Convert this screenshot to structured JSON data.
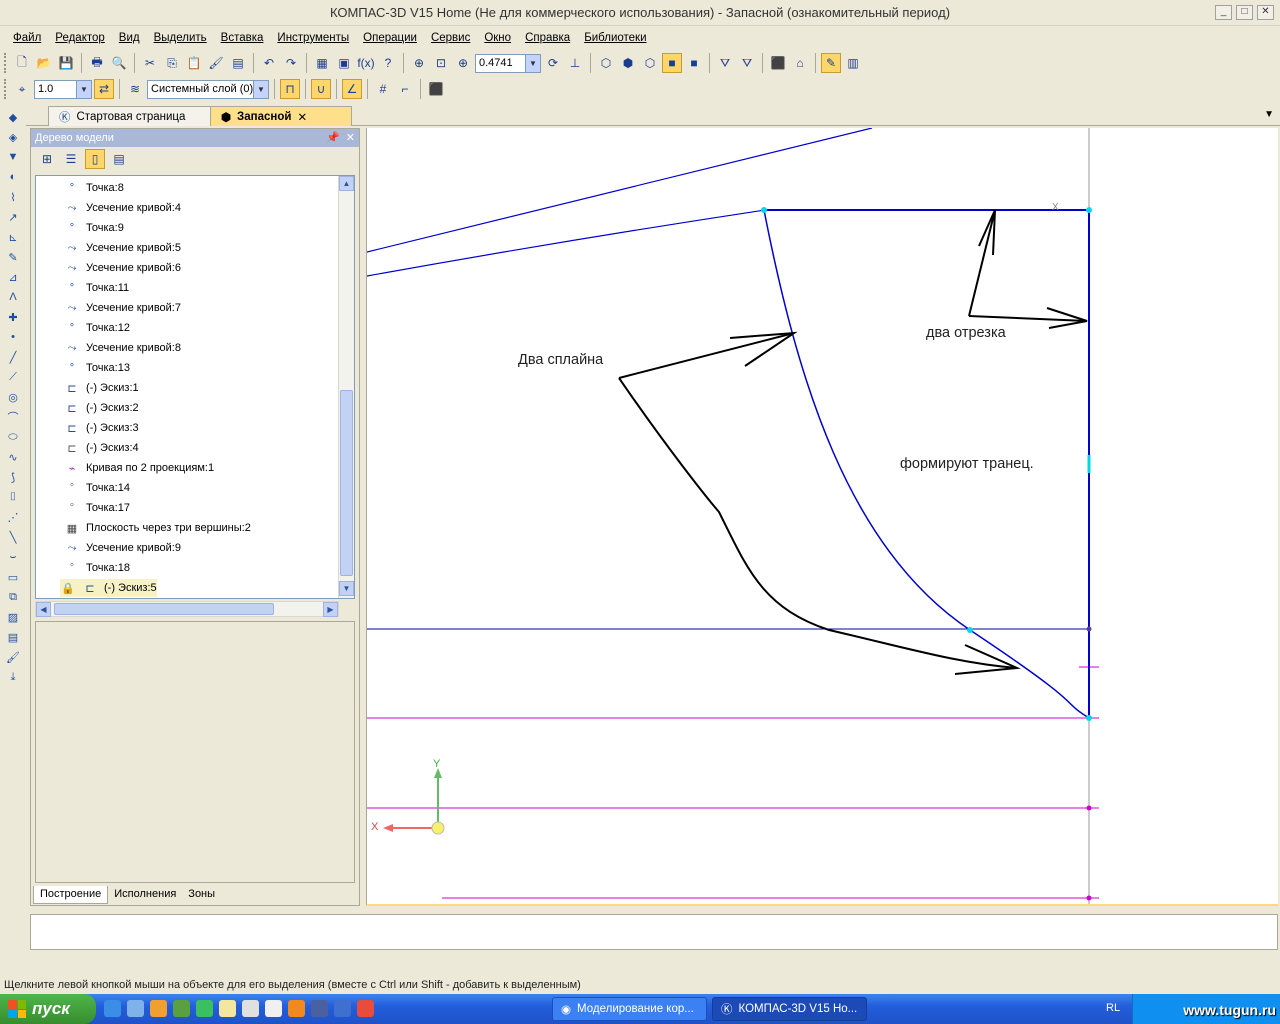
{
  "window": {
    "title": "КОМПАС-3D V15 Home (Не для коммерческого использования) - Запасной (ознакомительный период)",
    "min": "_",
    "max": "□",
    "close": "✕"
  },
  "menu": [
    "Файл",
    "Редактор",
    "Вид",
    "Выделить",
    "Вставка",
    "Инструменты",
    "Операции",
    "Сервис",
    "Окно",
    "Справка",
    "Библиотеки"
  ],
  "toolbar": {
    "zoom_value": "0.4741",
    "fx_label": "f(x)",
    "line_scale": "1.0",
    "layer_value": "Системный слой (0)"
  },
  "tabs": {
    "start_page": "Стартовая страница",
    "active_doc": "Запасной"
  },
  "tree": {
    "title": "Дерево модели",
    "items": [
      {
        "label": "Точка:8",
        "icon": "point-icon"
      },
      {
        "label": "Усечение кривой:4",
        "icon": "trim-curve-icon"
      },
      {
        "label": "Точка:9",
        "icon": "point-icon"
      },
      {
        "label": "Усечение кривой:5",
        "icon": "trim-curve-icon"
      },
      {
        "label": "Усечение кривой:6",
        "icon": "trim-curve-icon"
      },
      {
        "label": "Точка:11",
        "icon": "point-icon"
      },
      {
        "label": "Усечение кривой:7",
        "icon": "trim-curve-icon"
      },
      {
        "label": "Точка:12",
        "icon": "point-icon"
      },
      {
        "label": "Усечение кривой:8",
        "icon": "trim-curve-icon"
      },
      {
        "label": "Точка:13",
        "icon": "point-icon"
      },
      {
        "label": "(-) Эскиз:1",
        "icon": "sketch-icon"
      },
      {
        "label": "(-) Эскиз:2",
        "icon": "sketch-icon"
      },
      {
        "label": "(-) Эскиз:3",
        "icon": "sketch-icon"
      },
      {
        "label": "(-) Эскиз:4",
        "icon": "sketch-icon"
      },
      {
        "label": "Кривая по 2 проекциям:1",
        "icon": "curve-projection-icon"
      },
      {
        "label": "Точка:14",
        "icon": "point-icon"
      },
      {
        "label": "Точка:17",
        "icon": "point-icon"
      },
      {
        "label": "Плоскость через три вершины:2",
        "icon": "plane-icon"
      },
      {
        "label": "Усечение кривой:9",
        "icon": "trim-curve-icon"
      },
      {
        "label": "Точка:18",
        "icon": "point-icon"
      },
      {
        "label": "(-) Эскиз:5",
        "icon": "sketch-icon"
      }
    ],
    "tabs": [
      "Построение",
      "Исполнения",
      "Зоны"
    ]
  },
  "canvas": {
    "annotations": {
      "two_splines": "Два сплайна",
      "two_segments": "два отрезка",
      "form_transom": "формируют транец."
    },
    "axis_x": "X",
    "axis_y": "Y",
    "colors": {
      "curve": "#0000cc",
      "guide": "#cc00cc",
      "arrow": "#000000",
      "point": "#00d8e8"
    }
  },
  "status_bar": "Щелкните левой кнопкой мыши на объекте для его выделения (вместе с Ctrl или Shift - добавить к выделенным)",
  "taskbar": {
    "start": "пуск",
    "tasks": [
      "Моделирование кор...",
      "КОМПАС-3D V15 Ho..."
    ],
    "lang": "RL",
    "watermark": "www.tugun.ru"
  }
}
